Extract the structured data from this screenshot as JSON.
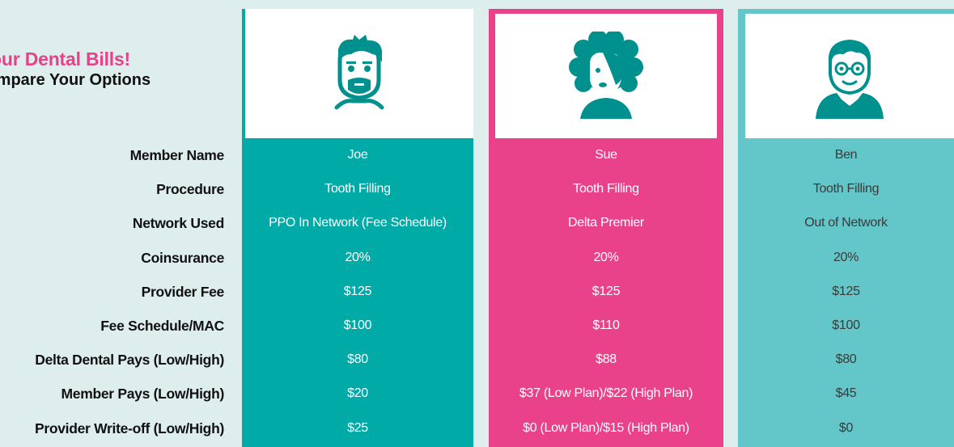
{
  "heading": {
    "line1": "n Your Dental Bills!",
    "line2": "Compare Your Options"
  },
  "row_labels": [
    "Member Name",
    "Procedure",
    "Network Used",
    "Coinsurance",
    "Provider Fee",
    "Fee Schedule/MAC",
    "Delta Dental Pays (Low/High)",
    "Member Pays (Low/High)",
    "Provider Write-off (Low/High)"
  ],
  "members": [
    {
      "name": "Joe",
      "procedure": "Tooth Filling",
      "network": "PPO In Network (Fee Schedule)",
      "coinsurance": "20%",
      "provider_fee": "$125",
      "fee_schedule": "$100",
      "delta_pays": "$80",
      "member_pays": "$20",
      "write_off": "$25"
    },
    {
      "name": "Sue",
      "procedure": "Tooth Filling",
      "network": "Delta Premier",
      "coinsurance": "20%",
      "provider_fee": "$125",
      "fee_schedule": "$110",
      "delta_pays": "$88",
      "member_pays": "$37 (Low Plan)/$22 (High Plan)",
      "write_off": "$0 (Low Plan)/$15 (High Plan)"
    },
    {
      "name": "Ben",
      "procedure": "Tooth Filling",
      "network": "Out of Network",
      "coinsurance": "20%",
      "provider_fee": "$125",
      "fee_schedule": "$100",
      "delta_pays": "$80",
      "member_pays": "$45",
      "write_off": "$0"
    }
  ],
  "colors": {
    "background": "#deeeed",
    "joe_column": "#00aaa7",
    "sue_column": "#ea428a",
    "ben_column": "#63c6c9",
    "heading_accent": "#e6428a"
  },
  "icons": {
    "joe": "bearded-man-avatar-icon",
    "sue": "curly-hair-woman-avatar-icon",
    "ben": "glasses-man-avatar-icon"
  }
}
